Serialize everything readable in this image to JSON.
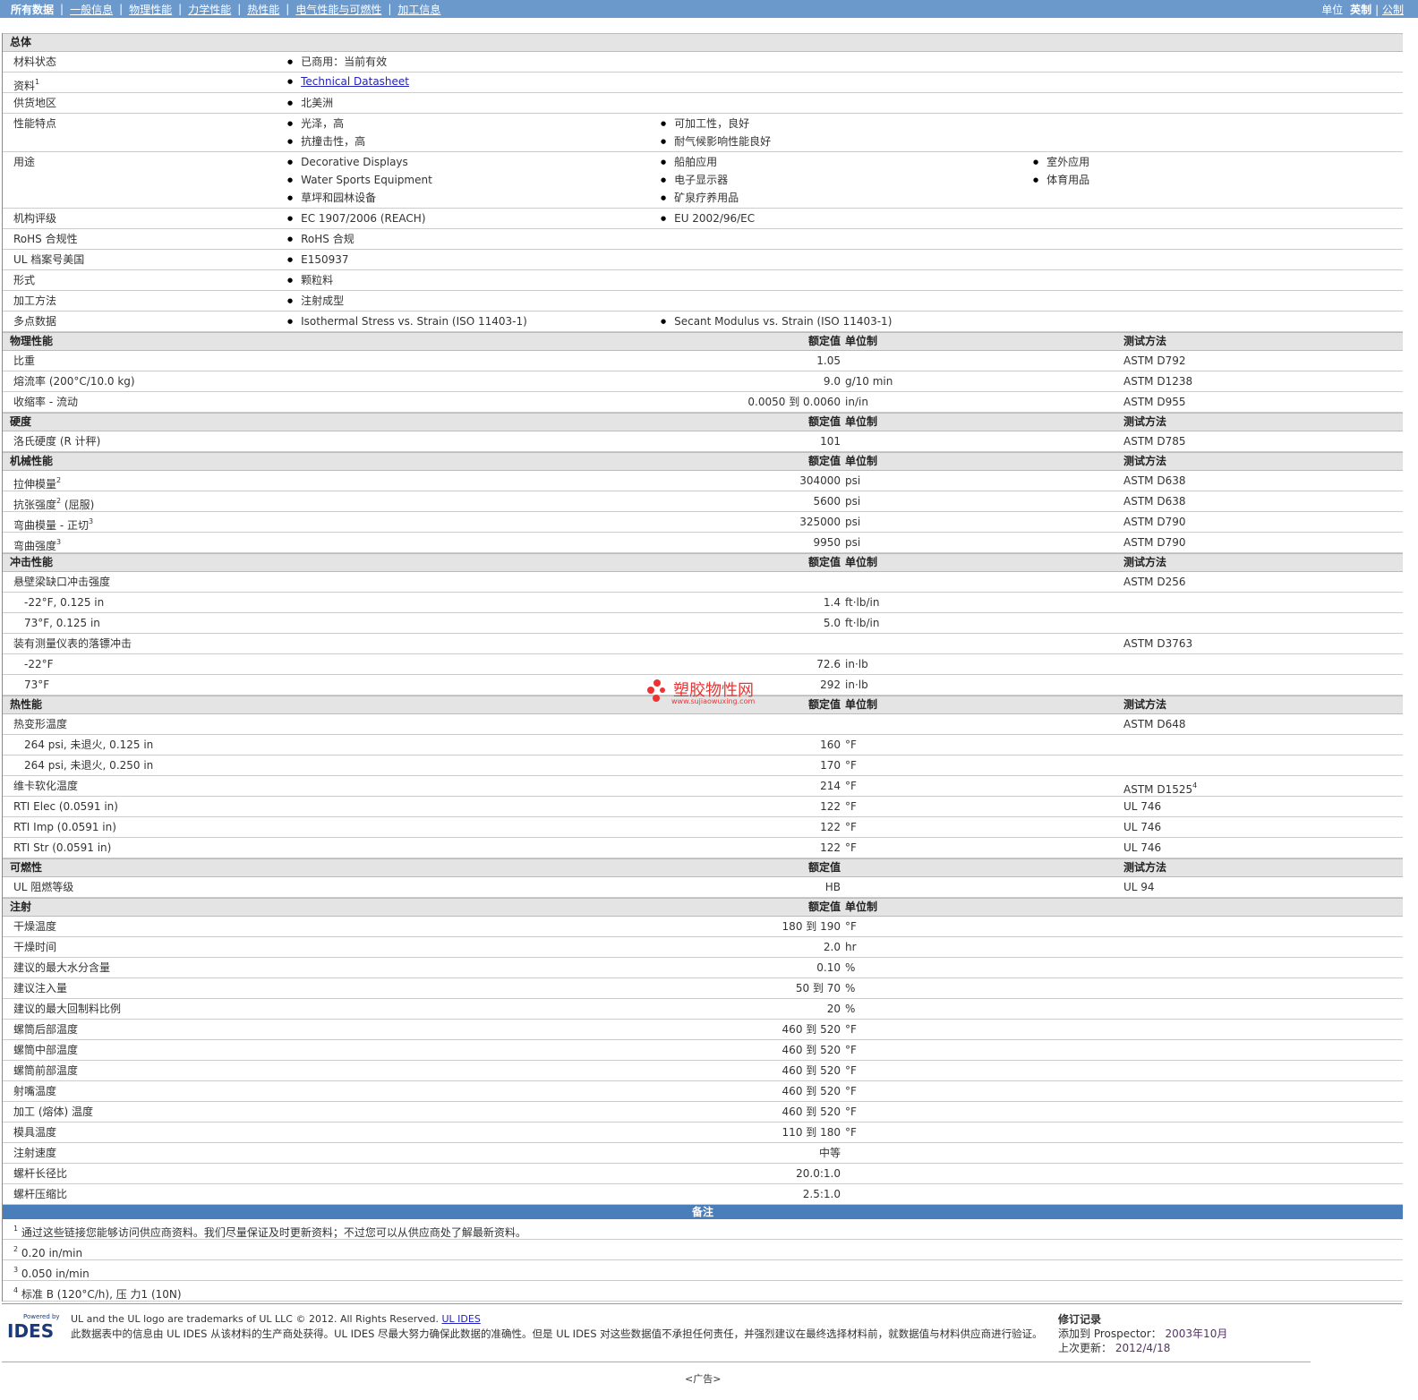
{
  "nav": {
    "items": [
      "所有数据",
      "一般信息",
      "物理性能",
      "力学性能",
      "热性能",
      "电气性能与可燃性",
      "加工信息"
    ],
    "units_label": "单位",
    "units": [
      "英制",
      "公制"
    ]
  },
  "general": {
    "title": "总体",
    "rows": [
      {
        "label": "材料状态",
        "cols": [
          [
            "已商用：当前有效"
          ]
        ]
      },
      {
        "label": "资料",
        "sup": "1",
        "link": "Technical Datasheet"
      },
      {
        "label": "供货地区",
        "cols": [
          [
            "北美洲"
          ]
        ]
      },
      {
        "label": "性能特点",
        "cols": [
          [
            "光泽，高",
            "抗撞击性，高"
          ],
          [
            "可加工性，良好",
            "耐气候影响性能良好"
          ]
        ]
      },
      {
        "label": "用途",
        "cols": [
          [
            "Decorative Displays",
            "Water Sports Equipment",
            "草坪和园林设备"
          ],
          [
            "船舶应用",
            "电子显示器",
            "矿泉疗养用品"
          ],
          [
            "室外应用",
            "体育用品"
          ]
        ]
      },
      {
        "label": "机构评级",
        "cols": [
          [
            "EC 1907/2006 (REACH)"
          ],
          [
            "EU 2002/96/EC"
          ]
        ]
      },
      {
        "label": "RoHS 合规性",
        "cols": [
          [
            "RoHS 合规"
          ]
        ]
      },
      {
        "label": "UL 档案号美国",
        "cols": [
          [
            "E150937"
          ]
        ]
      },
      {
        "label": "形式",
        "cols": [
          [
            "颗粒料"
          ]
        ]
      },
      {
        "label": "加工方法",
        "cols": [
          [
            "注射成型"
          ]
        ]
      },
      {
        "label": "多点数据",
        "cols": [
          [
            "Isothermal Stress vs. Strain (ISO 11403-1)"
          ],
          [
            "Secant Modulus vs. Strain (ISO 11403-1)"
          ]
        ]
      }
    ]
  },
  "sections": [
    {
      "title": "物理性能",
      "h": [
        "额定值",
        "单位制",
        "测试方法"
      ],
      "rows": [
        {
          "label": "比重",
          "value": "1.05",
          "unit": "",
          "method": "ASTM D792"
        },
        {
          "label": "熔流率 (200°C/10.0 kg)",
          "value": "9.0",
          "unit": "g/10 min",
          "method": "ASTM D1238"
        },
        {
          "label": "收缩率 - 流动",
          "value": "0.0050 到  0.0060",
          "unit": "in/in",
          "method": "ASTM D955"
        }
      ]
    },
    {
      "title": "硬度",
      "h": [
        "额定值",
        "单位制",
        "测试方法"
      ],
      "rows": [
        {
          "label": "洛氏硬度 (R 计秤)",
          "value": "101",
          "unit": "",
          "method": "ASTM D785"
        }
      ]
    },
    {
      "title": "机械性能",
      "h": [
        "额定值",
        "单位制",
        "测试方法"
      ],
      "rows": [
        {
          "label": "拉伸模量",
          "sup": "2",
          "value": "304000",
          "unit": "psi",
          "method": "ASTM D638"
        },
        {
          "label": "抗张强度",
          "sup": "2",
          "after": " (屈服)",
          "value": "5600",
          "unit": "psi",
          "method": "ASTM D638"
        },
        {
          "label": "弯曲模量 - 正切",
          "sup": "3",
          "value": "325000",
          "unit": "psi",
          "method": "ASTM D790"
        },
        {
          "label": "弯曲强度",
          "sup": "3",
          "value": "9950",
          "unit": "psi",
          "method": "ASTM D790"
        }
      ]
    },
    {
      "title": "冲击性能",
      "h": [
        "额定值",
        "单位制",
        "测试方法"
      ],
      "rows": [
        {
          "label": "悬壁梁缺口冲击强度",
          "value": "",
          "unit": "",
          "method": "ASTM D256"
        },
        {
          "label": "-22°F, 0.125 in",
          "indent": true,
          "value": "1.4",
          "unit": "ft·lb/in",
          "method": ""
        },
        {
          "label": "73°F, 0.125 in",
          "indent": true,
          "value": "5.0",
          "unit": "ft·lb/in",
          "method": ""
        },
        {
          "label": "装有测量仪表的落镖冲击",
          "value": "",
          "unit": "",
          "method": "ASTM D3763"
        },
        {
          "label": "-22°F",
          "indent": true,
          "value": "72.6",
          "unit": "in·lb",
          "method": ""
        },
        {
          "label": "73°F",
          "indent": true,
          "value": "292",
          "unit": "in·lb",
          "method": ""
        }
      ]
    },
    {
      "title": "热性能",
      "h": [
        "额定值",
        "单位制",
        "测试方法"
      ],
      "rows": [
        {
          "label": "热变形温度",
          "value": "",
          "unit": "",
          "method": "ASTM D648"
        },
        {
          "label": "264 psi, 未退火, 0.125 in",
          "indent": true,
          "value": "160",
          "unit": "°F",
          "method": ""
        },
        {
          "label": "264 psi, 未退火, 0.250 in",
          "indent": true,
          "value": "170",
          "unit": "°F",
          "method": ""
        },
        {
          "label": "维卡软化温度",
          "value": "214",
          "unit": "°F",
          "method": "ASTM D1525",
          "msup": "4"
        },
        {
          "label": "RTI Elec (0.0591 in)",
          "value": "122",
          "unit": "°F",
          "method": "UL 746"
        },
        {
          "label": "RTI Imp (0.0591 in)",
          "value": "122",
          "unit": "°F",
          "method": "UL 746"
        },
        {
          "label": "RTI Str (0.0591 in)",
          "value": "122",
          "unit": "°F",
          "method": "UL 746"
        }
      ]
    },
    {
      "title": "可燃性",
      "h": [
        "额定值",
        "",
        "测试方法"
      ],
      "rows": [
        {
          "label": "UL 阻燃等级",
          "value": "HB",
          "unit": "",
          "method": "UL 94"
        }
      ]
    },
    {
      "title": "注射",
      "h": [
        "额定值",
        "单位制",
        ""
      ],
      "rows": [
        {
          "label": "干燥温度",
          "value": "180 到  190",
          "unit": "°F",
          "method": ""
        },
        {
          "label": "干燥时间",
          "value": "2.0",
          "unit": "hr",
          "method": ""
        },
        {
          "label": "建议的最大水分含量",
          "value": "0.10",
          "unit": "%",
          "method": ""
        },
        {
          "label": "建议注入量",
          "value": "50 到  70",
          "unit": "%",
          "method": ""
        },
        {
          "label": "建议的最大回制料比例",
          "value": "20",
          "unit": "%",
          "method": ""
        },
        {
          "label": "螺筒后部温度",
          "value": "460 到  520",
          "unit": "°F",
          "method": ""
        },
        {
          "label": "螺筒中部温度",
          "value": "460 到  520",
          "unit": "°F",
          "method": ""
        },
        {
          "label": "螺筒前部温度",
          "value": "460 到  520",
          "unit": "°F",
          "method": ""
        },
        {
          "label": "射嘴温度",
          "value": "460 到  520",
          "unit": "°F",
          "method": ""
        },
        {
          "label": "加工 (熔体) 温度",
          "value": "460 到  520",
          "unit": "°F",
          "method": ""
        },
        {
          "label": "模具温度",
          "value": "110 到  180",
          "unit": "°F",
          "method": ""
        },
        {
          "label": "注射速度",
          "value": "中等",
          "unit": "",
          "method": ""
        },
        {
          "label": "螺杆长径比",
          "value": "20.0:1.0",
          "unit": "",
          "method": ""
        },
        {
          "label": "螺杆压缩比",
          "value": "2.5:1.0",
          "unit": "",
          "method": ""
        }
      ]
    }
  ],
  "notes": {
    "title": "备注",
    "items": [
      {
        "n": "1",
        "text": "通过这些链接您能够访问供应商资料。我们尽量保证及时更新资料；不过您可以从供应商处了解最新资料。"
      },
      {
        "n": "2",
        "text": "0.20 in/min"
      },
      {
        "n": "3",
        "text": "0.050 in/min"
      },
      {
        "n": "4",
        "text": "标准 B (120°C/h), 压 力1 (10N)"
      }
    ]
  },
  "footer": {
    "logo_powered": "Powered by",
    "logo": "IDES",
    "trademark": "UL and the UL logo are trademarks of UL LLC © 2012. All Rights Reserved.",
    "trademark_link": "UL IDES",
    "disclaimer": "此数据表中的信息由 UL IDES 从该材料的生产商处获得。UL IDES 尽最大努力确保此数据的准确性。但是 UL IDES 对这些数据值不承担任何责任，并强烈建议在最终选择材料前，就数据值与材料供应商进行验证。",
    "rev_title": "修订记录",
    "added_label": "添加到 Prospector：",
    "added": "2003年10月",
    "updated_label": "上次更新：",
    "updated": "2012/4/18",
    "ad": "<广告>"
  },
  "watermark": {
    "text": "塑胶物性网",
    "url": "www.sujiaowuxing.com"
  },
  "colors": {
    "bar": "#6b99cc",
    "notes": "#4a7ebb",
    "section": "#e4e4e4"
  }
}
